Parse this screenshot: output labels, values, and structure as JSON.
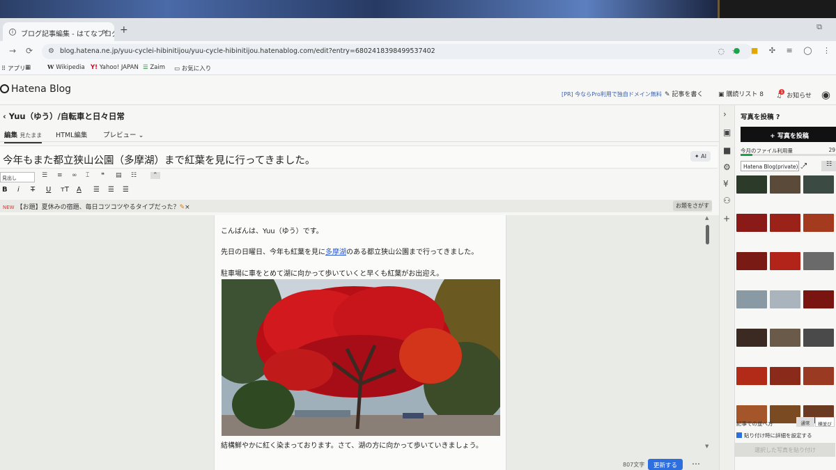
{
  "browser": {
    "tab_title": "ブログ記事編集 - はてなブログ",
    "tab_close": "×",
    "new_tab": "+",
    "url": "blog.hatena.ne.jp/yuu-cyclei-hibinitijou/yuu-cycle-hibinitijou.hatenablog.com/edit?entry=6802418398499537402",
    "bookmarks": [
      {
        "label": "アプリ"
      },
      {
        "label": "Wikipedia",
        "mark": "W"
      },
      {
        "label": "Yahoo! JAPAN",
        "mark": "Y!"
      },
      {
        "label": "Zaim"
      },
      {
        "label": "お気に入り"
      }
    ]
  },
  "header": {
    "logo": "Hatena Blog",
    "pr_text": "[PR] 今ならPro利用で独自ドメイン無料",
    "write_label": "記事を書く",
    "subscribe_label": "購読リスト",
    "subscribe_count": "8",
    "notify_label": "お知らせ",
    "notify_count": "1"
  },
  "editor": {
    "blog_name": "Yuu（ゆう）/自転車と日々日常",
    "modes": {
      "edit": "編集",
      "edit_sub": "見たまま",
      "html": "HTML編集",
      "preview": "プレビュー"
    },
    "title": "今年もまた都立狭山公園（多摩湖）まで紅葉を見に行ってきました。",
    "ai_label": "AI",
    "format_select": "見出し",
    "topic": {
      "new_label": "NEW",
      "text": "【お題】夏休みの宿題、毎日コツコツやるタイプだった？",
      "find_button": "お題をさがす"
    },
    "body": {
      "p1": "こんばんは、Yuu（ゆう）です。",
      "p2_before": "先日の日曜日、今年も紅葉を見に",
      "p2_link": "多摩湖",
      "p2_after": "のある都立狭山公園まで行ってきました。",
      "p3": "駐車場に車をとめて湖に向かって歩いていくと早くも紅葉がお出迎え。",
      "p4": "結構鮮やかに紅く染まっております。さて、湖の方に向かって歩いていきましょう。"
    },
    "char_count": "807文字",
    "update_button": "更新する"
  },
  "sidebar": {
    "title": "写真を投稿",
    "upload_button": "写真を投稿",
    "usage_label": "今月のファイル利用量",
    "usage_value": "29",
    "usage_fraction": 0.12,
    "album": "Hatena Blog(private)",
    "sort_label": "記事での並べ方",
    "sort_normal": "通常",
    "sort_horizontal": "横並び",
    "paste_option": "貼り付け時に詳細を設定する",
    "insert_button": "選択した写真を貼り付け"
  },
  "colors": {
    "accent": "#2e6fe0",
    "link": "#2a5bd7",
    "notify": "#e5322d"
  }
}
